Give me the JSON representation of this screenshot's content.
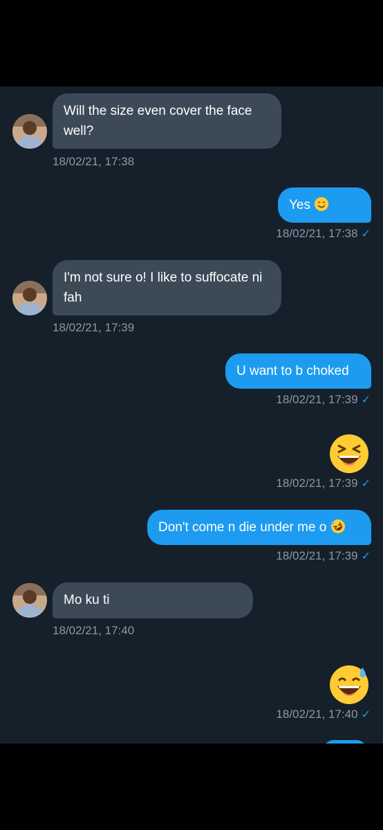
{
  "colors": {
    "chat_background": "#15202b",
    "incoming_bubble": "#3c4a57",
    "outgoing_bubble": "#1d9bf0",
    "timestamp": "#8b98a5",
    "read_check": "#1d9bf0"
  },
  "messages": [
    {
      "direction": "incoming",
      "text": "Will the size even cover the face well?",
      "time": "18/02/21, 17:38",
      "avatar": "contact-avatar"
    },
    {
      "direction": "outgoing",
      "text": "Yes",
      "emoji": "smiling-face-icon",
      "time": "18/02/21, 17:38",
      "status": "✓"
    },
    {
      "direction": "incoming",
      "text": "I'm not sure o! I like to suffocate ni fah",
      "time": "18/02/21, 17:39",
      "avatar": "contact-avatar"
    },
    {
      "direction": "outgoing",
      "text": "U want to b choked",
      "time": "18/02/21, 17:39",
      "status": "✓"
    },
    {
      "direction": "outgoing",
      "emoji": "laughing-squinting-face-icon",
      "time": "18/02/21, 17:39",
      "status": "✓"
    },
    {
      "direction": "outgoing",
      "text": "Don't come n die under me o",
      "emoji": "rolling-on-floor-laughing-icon",
      "time": "18/02/21, 17:39",
      "status": "✓"
    },
    {
      "direction": "incoming",
      "text": "Mo ku ti",
      "time": "18/02/21, 17:40",
      "avatar": "contact-avatar"
    },
    {
      "direction": "outgoing",
      "emoji": "grinning-face-with-sweat-icon",
      "time": "18/02/21, 17:40",
      "status": "✓"
    }
  ]
}
